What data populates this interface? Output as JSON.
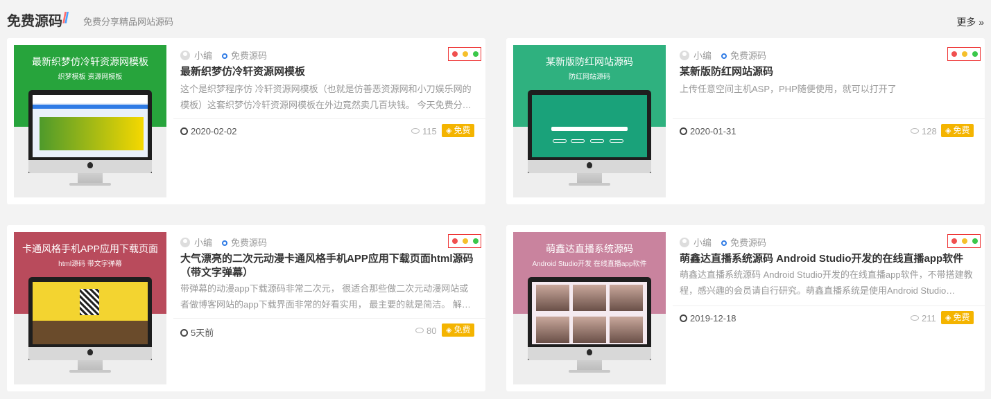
{
  "section": {
    "title": "免费源码",
    "subtitle": "免费分享精品网站源码",
    "more": "更多 »"
  },
  "colors": {
    "accent_blue": "#2f7be5",
    "badge": "#f4b400",
    "dot_red": "#f0504f",
    "dot_yellow": "#f5c02b",
    "dot_green": "#3ac84a"
  },
  "cards": [
    {
      "thumb_title": "最新织梦仿冷轩资源网模板",
      "thumb_subtitle": "织梦模板 资源网模板",
      "thumb_color": "#27a43c",
      "author": "小编",
      "category": "免费源码",
      "title": "最新织梦仿冷轩资源网模板",
      "description": "这个是织梦程序仿 冷轩资源网模板（也就是仿善恶资源网和小刀娱乐网的模板）这套织梦仿冷轩资源网模板在外边竟然卖几百块钱。 今天免费分…",
      "date": "2020-02-02",
      "views": "115",
      "badge": "免费"
    },
    {
      "thumb_title": "某新版防红网站源码",
      "thumb_subtitle": "防红网站源码",
      "thumb_color": "#2fb17f",
      "author": "小编",
      "category": "免费源码",
      "title": "某新版防红网站源码",
      "description": "上传任意空间主机ASP，PHP随便使用，就可以打开了",
      "date": "2020-01-31",
      "views": "128",
      "badge": "免费"
    },
    {
      "thumb_title": "卡通风格手机APP应用下载页面",
      "thumb_subtitle": "html源码 带文字弹幕",
      "thumb_color": "#b94b5c",
      "author": "小编",
      "category": "免费源码",
      "title": "大气漂亮的二次元动漫卡通风格手机APP应用下载页面html源码（带文字弹幕）",
      "description": "带弹幕的动漫app下载源码非常二次元， 很适合那些做二次元动漫网站或者做博客网站的app下载界面非常的好看实用， 最主要的就是简洁。 解…",
      "date": "5天前",
      "views": "80",
      "badge": "免费"
    },
    {
      "thumb_title": "萌鑫达直播系统源码",
      "thumb_subtitle": "Android Studio开发 在线直播app软件",
      "thumb_color": "#c9839e",
      "author": "小编",
      "category": "免费源码",
      "title": "萌鑫达直播系统源码 Android Studio开发的在线直播app软件",
      "description": "萌鑫达直播系统源码 Android Studio开发的在线直播app软件，不带搭建教程，感兴趣的会员请自行研究。萌鑫直播系统是使用Android Studio…",
      "date": "2019-12-18",
      "views": "211",
      "badge": "免费"
    }
  ]
}
